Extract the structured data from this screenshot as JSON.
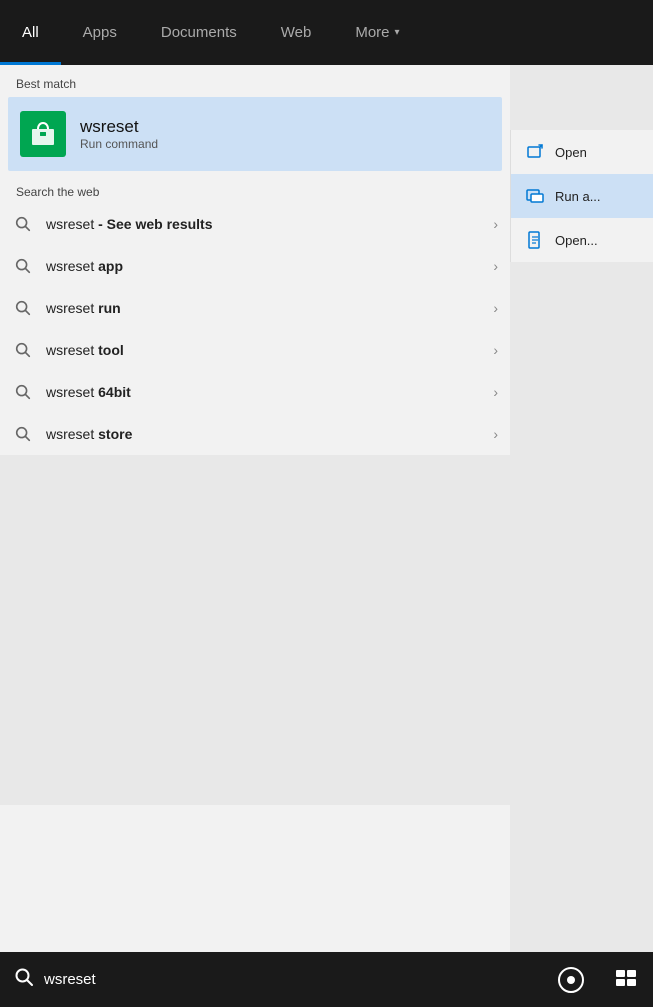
{
  "nav": {
    "tabs": [
      {
        "id": "all",
        "label": "All",
        "active": true
      },
      {
        "id": "apps",
        "label": "Apps",
        "active": false
      },
      {
        "id": "documents",
        "label": "Documents",
        "active": false
      },
      {
        "id": "web",
        "label": "Web",
        "active": false
      },
      {
        "id": "more",
        "label": "More",
        "active": false,
        "has_chevron": true
      }
    ]
  },
  "best_match": {
    "section_label": "Best match",
    "title": "wsreset",
    "subtitle": "Run command",
    "icon_label": "store-icon"
  },
  "web_search": {
    "section_label": "Search the web",
    "items": [
      {
        "text_normal": "wsreset",
        "text_bold": "- See web results",
        "has_bold": true
      },
      {
        "text_normal": "wsreset",
        "text_bold": "app",
        "has_bold": true
      },
      {
        "text_normal": "wsreset",
        "text_bold": "run",
        "has_bold": true
      },
      {
        "text_normal": "wsreset",
        "text_bold": "tool",
        "has_bold": true
      },
      {
        "text_normal": "wsreset",
        "text_bold": "64bit",
        "has_bold": true
      },
      {
        "text_normal": "wsreset",
        "text_bold": "store",
        "has_bold": true
      }
    ]
  },
  "context_menu": {
    "items": [
      {
        "label": "Open",
        "icon": "open-window-icon"
      },
      {
        "label": "Run a...",
        "icon": "run-icon"
      },
      {
        "label": "Open...",
        "icon": "file-icon"
      }
    ]
  },
  "taskbar": {
    "search_value": "wsreset",
    "search_placeholder": "wsreset",
    "circle_btn_label": "Cortana",
    "grid_btn_label": "Task View"
  }
}
